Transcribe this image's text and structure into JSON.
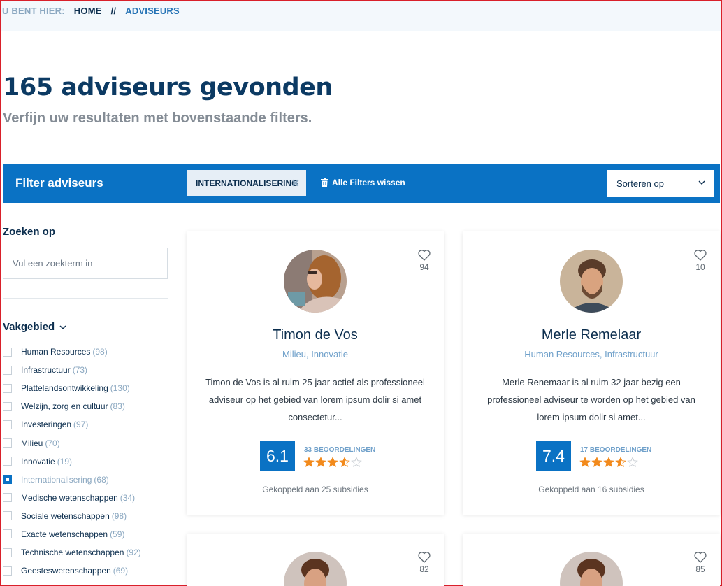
{
  "breadcrumb": {
    "prefix": "U BENT HIER:",
    "home": "HOME",
    "separator": "//",
    "current": "ADVISEURS"
  },
  "header": {
    "title": "165 adviseurs gevonden",
    "subtitle": "Verfijn uw resultaten met bovenstaande filters."
  },
  "filterbar": {
    "title": "Filter adviseurs",
    "active_chip": "INTERNATIONALISERING",
    "clear_all": "Alle Filters wissen",
    "sort_label": "Sorteren op"
  },
  "sidebar": {
    "search_label": "Zoeken op",
    "search_placeholder": "Vul een zoekterm in",
    "facet_title": "Vakgebied",
    "facets": [
      {
        "name": "Human Resources",
        "count": "(98)",
        "checked": false
      },
      {
        "name": "Infrastructuur",
        "count": "(73)",
        "checked": false
      },
      {
        "name": "Plattelandsontwikkeling",
        "count": "(130)",
        "checked": false
      },
      {
        "name": "Welzijn, zorg en cultuur",
        "count": "(83)",
        "checked": false
      },
      {
        "name": "Investeringen",
        "count": "(97)",
        "checked": false
      },
      {
        "name": "Milieu",
        "count": "(70)",
        "checked": false
      },
      {
        "name": "Innovatie",
        "count": "(19)",
        "checked": false
      },
      {
        "name": "Internationalisering",
        "count": "(68)",
        "checked": true
      },
      {
        "name": "Medische wetenschappen",
        "count": "(34)",
        "checked": false
      },
      {
        "name": "Sociale wetenschappen",
        "count": "(98)",
        "checked": false
      },
      {
        "name": "Exacte wetenschappen",
        "count": "(59)",
        "checked": false
      },
      {
        "name": "Technische wetenschappen",
        "count": "(92)",
        "checked": false
      },
      {
        "name": "Geesteswetenschappen",
        "count": "(69)",
        "checked": false
      }
    ]
  },
  "cards": [
    {
      "name": "Timon de Vos",
      "tags": "Milieu, Innovatie",
      "description": "Timon de Vos is al ruim 25 jaar actief als professioneel adviseur op het gebied van lorem ipsum dolir si amet consectetur...",
      "score": "6.1",
      "reviews": "33 BEOORDELINGEN",
      "rating": 3.5,
      "linked": "Gekoppeld aan 25 subsidies",
      "favorites": "94"
    },
    {
      "name": "Merle Remelaar",
      "tags": "Human Resources, Infrastructuur",
      "description": "Merle Renemaar is al ruim 32 jaar bezig een professioneel adviseur te worden op het gebied van lorem ipsum dolir si amet...",
      "score": "7.4",
      "reviews": "17 BEOORDELINGEN",
      "rating": 3.5,
      "linked": "Gekoppeld aan 16 subsidies",
      "favorites": "10"
    },
    {
      "favorites": "82"
    },
    {
      "favorites": "85"
    }
  ],
  "colors": {
    "primary": "#0a72c4",
    "navy": "#0c2e4e",
    "star": "#f28a1c",
    "muted": "#8aa7c0"
  }
}
